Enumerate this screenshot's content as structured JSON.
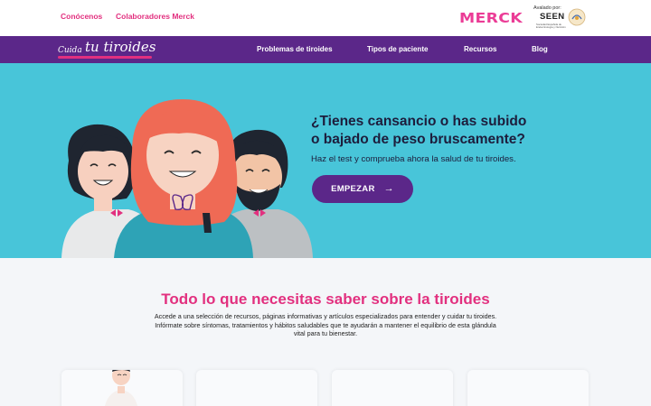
{
  "topbar": {
    "links": [
      "Conócenos",
      "Colaboradores Merck"
    ],
    "merck_logo": "MERCK",
    "seen": {
      "avalado": "Avalado por:",
      "name": "SEEN",
      "subtitle": "Sociedad Española de Endocrinología y Nutrición"
    }
  },
  "nav": {
    "brand_small": "Cuida",
    "brand_big": "tu tiroides",
    "items": [
      "Problemas de tiroides",
      "Tipos de paciente",
      "Recursos",
      "Blog"
    ]
  },
  "hero": {
    "title_line1": "¿Tienes cansancio o has subido",
    "title_line2": "o bajado de peso bruscamente?",
    "subtitle": "Haz el test y comprueba ahora la salud de tu tiroides.",
    "cta_label": "EMPEZAR",
    "cta_icon": "arrow-right-icon"
  },
  "section": {
    "title": "Todo lo que necesitas saber sobre la tiroides",
    "desc_line1": "Accede a una selección de recursos, páginas informativas y artículos especializados para entender y cuidar tu tiroides.",
    "desc_line2": "Infórmate sobre síntomas, tratamientos y hábitos saludables que te ayudarán a mantener el equilibrio de esta glándula",
    "desc_line3": "vital para tu bienestar."
  },
  "colors": {
    "purple": "#5b2789",
    "pink": "#e2307f",
    "hero_bg": "#48c5d9",
    "dark_text": "#1d1d3c"
  }
}
